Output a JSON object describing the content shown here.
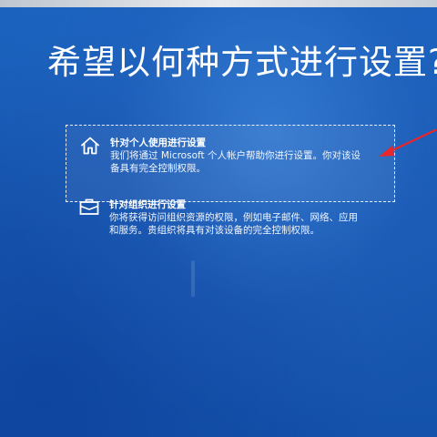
{
  "page": {
    "title": "希望以何种方式进行设置?"
  },
  "options": [
    {
      "icon": "home-icon",
      "title": "针对个人使用进行设置",
      "desc_lines": [
        "我们将通过 Microsoft 个人帐户帮助你进行设置。你对该设",
        "备具有完全控制权限。"
      ]
    },
    {
      "icon": "briefcase-icon",
      "title": "针对组织进行设置",
      "desc_lines": [
        "你将获得访问组织资源的权限，例如电子邮件、网络、应用",
        "和服务。贵组织将具有对该设备的完全控制权限。"
      ]
    }
  ],
  "colors": {
    "background": "#1a5bb5",
    "text": "#ffffff",
    "annotation_arrow": "#e8262b"
  }
}
